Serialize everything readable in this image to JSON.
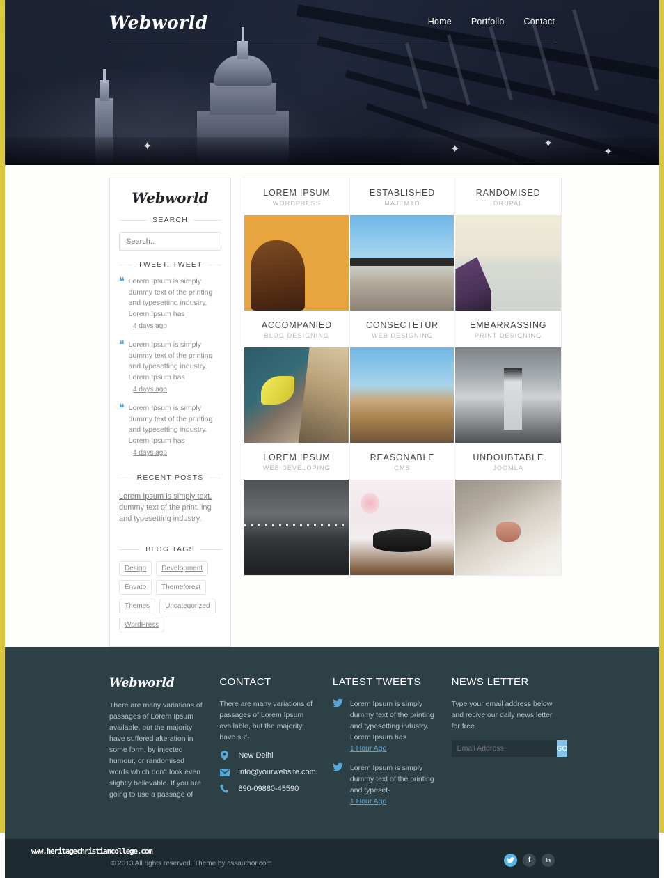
{
  "site": {
    "brand": "Webworld",
    "hero_rule": true
  },
  "nav": {
    "items": [
      {
        "label": "Home"
      },
      {
        "label": "Portfolio"
      },
      {
        "label": "Contact"
      }
    ]
  },
  "sidebar": {
    "brand": "Webworld",
    "search": {
      "heading": "SEARCH",
      "placeholder": "Search..",
      "value": ""
    },
    "tweets": {
      "heading": "TWEET. TWEET",
      "items": [
        {
          "text": "Lorem Ipsum is simply dummy text of the printing and typesetting industry. Lorem Ipsum has",
          "time": "4 days ago"
        },
        {
          "text": "Lorem Ipsum is simply dummy text of the printing and typesetting industry. Lorem Ipsum has",
          "time": "4 days ago"
        },
        {
          "text": "Lorem Ipsum is simply dummy text of the printing and typesetting industry. Lorem Ipsum has",
          "time": "4 days ago"
        }
      ]
    },
    "recent_posts": {
      "heading": "RECENT POSTS",
      "link": "Lorem Ipsum is simply text.",
      "text": "dummy text of the print. ing and typesetting industry."
    },
    "blog_tags": {
      "heading": "BLOG TAGS",
      "items": [
        "Design",
        "Development",
        "Envato",
        "Themeforest",
        "Themes",
        "Uncategorized",
        "WordPress"
      ]
    }
  },
  "portfolio": {
    "rows": [
      {
        "captions": [
          {
            "title": "LOREM IPSUM",
            "sub": "WORDPRESS"
          },
          {
            "title": "ESTABLISHED",
            "sub": "MAJEMTO"
          },
          {
            "title": "RANDOMISED",
            "sub": "DRUPAL"
          }
        ],
        "thumbs": [
          "sunset-girl-field-photo",
          "beach-blue-sky-photo",
          "boat-frozen-lake-photo"
        ]
      },
      {
        "captions": [
          {
            "title": "ACCOMPANIED",
            "sub": "BLOG DESIGNING"
          },
          {
            "title": "CONSECTETUR",
            "sub": "WEB DESIGNING"
          },
          {
            "title": "EMBARRASSING",
            "sub": "PRINT DESIGNING"
          }
        ],
        "thumbs": [
          "yellow-leaves-cliff-photo",
          "desert-badlands-photo",
          "lighthouse-bw-photo"
        ]
      },
      {
        "captions": [
          {
            "title": "LOREM IPSUM",
            "sub": "WEB DEVELOPING"
          },
          {
            "title": "REASONABLE",
            "sub": "CMS"
          },
          {
            "title": "UNDOUBTABLE",
            "sub": "JOOMLA"
          }
        ],
        "thumbs": [
          "brooklyn-bridge-night-photo",
          "turntable-needle-photo",
          "cat-nose-photo"
        ]
      }
    ]
  },
  "footer": {
    "about": {
      "brand": "Webworld",
      "text": "There are many variations of passages of Lorem Ipsum available, but the majority have suffered alteration in some form, by injected humour, or randomised words which don't look even slightly believable. If you are going to use a passage of"
    },
    "contact": {
      "heading": "CONTACT",
      "text": "There are many variations of passages of Lorem Ipsum available, but the majority have suf-",
      "address": "New Delhi",
      "email": "info@yourwebsite.com",
      "phone": "890-09880-45590"
    },
    "tweets": {
      "heading": "LATEST TWEETS",
      "items": [
        {
          "text": "Lorem Ipsum is simply dummy text of the printing and typesetting industry. Lorem Ipsum has",
          "time": "1 Hour Ago"
        },
        {
          "text": "Lorem Ipsum is simply dummy text of the printing and typeset-",
          "time": "1 Hour Ago"
        }
      ]
    },
    "newsletter": {
      "heading": "NEWS LETTER",
      "text": "Type your email address below and recive our daily news letter for free",
      "placeholder": "Email Address",
      "value": "",
      "button": "GO"
    }
  },
  "bottom": {
    "watermark": "www.heritagechristiancollege.com",
    "copyright": "© 2013 All rights reserved.  Theme by cssauthor.com",
    "socials": [
      {
        "name": "twitter",
        "glyph": "t"
      },
      {
        "name": "facebook",
        "glyph": "f"
      },
      {
        "name": "linkedin",
        "glyph": "in"
      }
    ]
  },
  "colors": {
    "accent_border": "#d9c73c",
    "footer_bg": "#2d4046",
    "bottom_bg": "#1d2a30",
    "link_blue": "#57a7d8"
  }
}
